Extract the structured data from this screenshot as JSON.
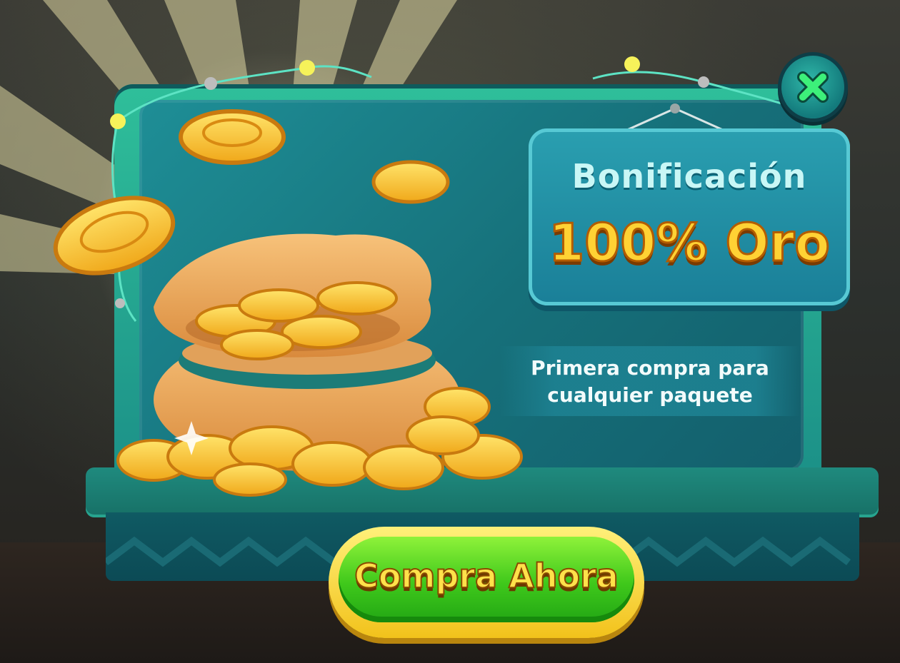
{
  "promo": {
    "title": "Bonificación",
    "amount": "100% Oro",
    "subtitle_line1": "Primera compra para",
    "subtitle_line2": "cualquier paquete"
  },
  "buttons": {
    "buy_label": "Compra Ahora",
    "close_icon": "close-x-icon"
  },
  "colors": {
    "board": "#1a8c86",
    "sign": "#1a7f98",
    "gold": "#ffd234",
    "buy_green": "#3fc81b",
    "buy_rim": "#f2c21b",
    "close_x": "#2ee86a"
  },
  "icons": [
    "coin-icon",
    "gold-bag-icon",
    "close-x-icon",
    "light-bulb-icon"
  ]
}
